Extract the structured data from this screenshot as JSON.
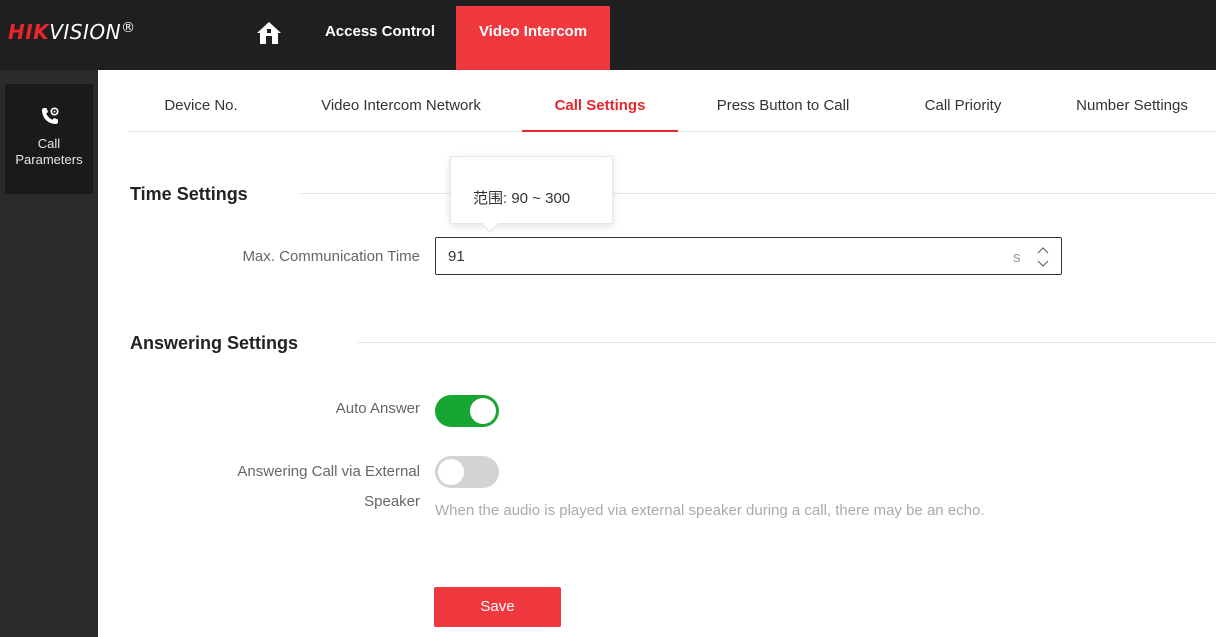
{
  "brand": {
    "name_red": "HIK",
    "name_white": "VISION",
    "reg_mark": "®",
    "accent_color": "#e8262d"
  },
  "topnav": {
    "home_icon": "home-icon",
    "items": [
      {
        "label": "Access Control",
        "active": false
      },
      {
        "label": "Video Intercom",
        "active": true
      }
    ]
  },
  "sidebar": {
    "items": [
      {
        "icon": "phone-gear-icon",
        "label": "Call\nParameters",
        "active": true
      }
    ]
  },
  "tabs": [
    {
      "label": "Device No.",
      "active": false
    },
    {
      "label": "Video Intercom Network",
      "active": false
    },
    {
      "label": "Call Settings",
      "active": true
    },
    {
      "label": "Press Button to Call",
      "active": false
    },
    {
      "label": "Call Priority",
      "active": false
    },
    {
      "label": "Number Settings",
      "active": false
    }
  ],
  "time_settings": {
    "heading": "Time Settings",
    "max_comm_time": {
      "label": "Max. Communication Time",
      "value": "91",
      "unit": "s",
      "tooltip": "范围: 90 ~ 300"
    }
  },
  "answering_settings": {
    "heading": "Answering Settings",
    "auto_answer": {
      "label": "Auto Answer",
      "enabled": true
    },
    "external_speaker": {
      "label_line1": "Answering Call via External",
      "label_line2": "Speaker",
      "enabled": false,
      "hint": "When the audio is played via external speaker during a call, there may be an echo."
    }
  },
  "actions": {
    "save_label": "Save"
  }
}
